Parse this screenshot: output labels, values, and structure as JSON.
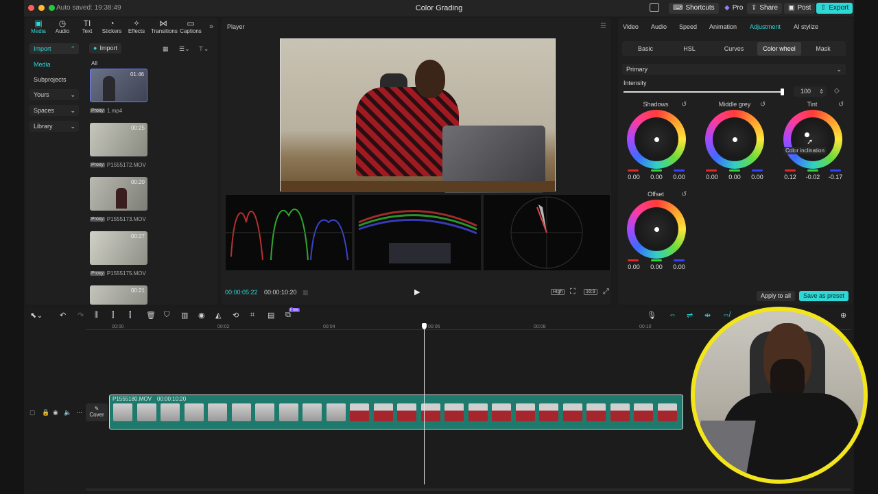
{
  "titlebar": {
    "autosave": "Auto saved: 19:38:49",
    "title": "Color Grading",
    "shortcuts": "Shortcuts",
    "pro": "Pro",
    "share": "Share",
    "post": "Post",
    "export": "Export"
  },
  "toolbar": {
    "items": [
      "Media",
      "Audio",
      "Text",
      "Stickers",
      "Effects",
      "Transitions",
      "Captions"
    ]
  },
  "sidebar": {
    "import": "Import",
    "items": [
      "Media",
      "Subprojects",
      "Yours",
      "Spaces",
      "Library"
    ]
  },
  "media": {
    "import_button": "Import",
    "all_label": "All",
    "clips": [
      {
        "duration": "01:46",
        "name": "1.mp4",
        "proxy": "Proxy"
      },
      {
        "duration": "00:25",
        "name": "P1555172.MOV",
        "proxy": "Proxy"
      },
      {
        "duration": "00:20",
        "name": "P1555173.MOV",
        "proxy": "Proxy"
      },
      {
        "duration": "00:27",
        "name": "P1555175.MOV",
        "proxy": "Proxy"
      },
      {
        "duration": "00:21",
        "name": "",
        "proxy": ""
      }
    ]
  },
  "player": {
    "label": "Player",
    "current_time": "00:00:05:22",
    "total_time": "00:00:10:20",
    "quality": "High",
    "ratio": "16:9"
  },
  "right_panel": {
    "tabs": [
      "Video",
      "Audio",
      "Speed",
      "Animation",
      "Adjustment",
      "AI stylize"
    ],
    "active_tab": "Adjustment",
    "subtabs": [
      "Basic",
      "HSL",
      "Curves",
      "Color wheel",
      "Mask"
    ],
    "active_subtab": "Color wheel",
    "mode": "Primary",
    "intensity_label": "Intensity",
    "intensity_value": "100",
    "wheels": [
      {
        "name": "Shadows",
        "values": [
          "0.00",
          "0.00",
          "0.00"
        ]
      },
      {
        "name": "Middle grey",
        "values": [
          "0.00",
          "0.00",
          "0.00"
        ]
      },
      {
        "name": "Tint",
        "values": [
          "0.12",
          "-0.02",
          "-0.17"
        ]
      },
      {
        "name": "Offset",
        "values": [
          "0.00",
          "0.00",
          "0.00"
        ]
      }
    ],
    "tooltip": "Color inclination",
    "apply_all": "Apply to all",
    "save_preset": "Save as preset"
  },
  "timeline": {
    "ticks": [
      "00:00",
      "00:02",
      "00:04",
      "00:06",
      "00:08",
      "00:10"
    ],
    "free_badge": "Free",
    "clip_name": "P1555180.MOV",
    "clip_duration": "00:00:10:20",
    "cover_label": "Cover"
  },
  "colors": {
    "accent": "#2fd7d5",
    "clip": "#1e7a6c",
    "webcam_ring": "#f2e51c"
  }
}
